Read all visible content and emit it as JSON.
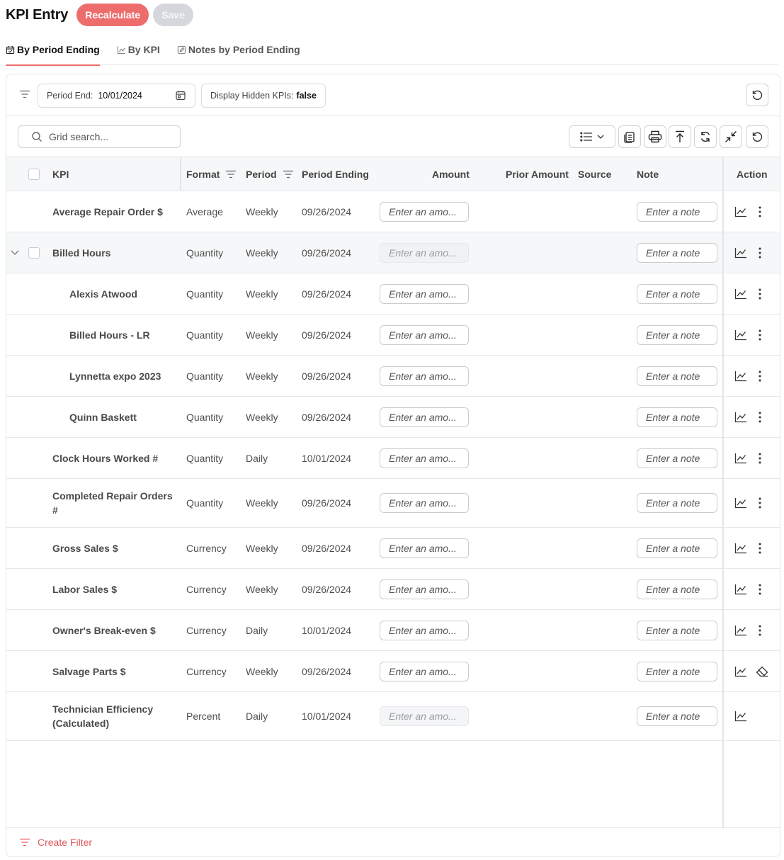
{
  "header": {
    "title": "KPI Entry",
    "recalculate_label": "Recalculate",
    "save_label": "Save"
  },
  "tabs": [
    {
      "label": "By Period Ending",
      "icon": "calendar-check-icon",
      "active": true
    },
    {
      "label": "By KPI",
      "icon": "chart-line-icon",
      "active": false
    },
    {
      "label": "Notes by Period Ending",
      "icon": "edit-note-icon",
      "active": false
    }
  ],
  "filters": {
    "period_end_label": "Period End:",
    "period_end_value": "10/01/2024",
    "hidden_label": "Display Hidden KPIs:",
    "hidden_value": "false"
  },
  "search": {
    "placeholder": "Grid search..."
  },
  "columns": {
    "kpi": "KPI",
    "format": "Format",
    "period": "Period",
    "period_ending": "Period Ending",
    "amount": "Amount",
    "prior_amount": "Prior Amount",
    "source": "Source",
    "note": "Note",
    "action": "Action"
  },
  "placeholders": {
    "amount": "Enter an amo...",
    "note": "Enter a note"
  },
  "rows": [
    {
      "kpi": "Average Repair Order $",
      "format": "Average",
      "period": "Weekly",
      "period_ending": "09/26/2024",
      "child": false,
      "amount_disabled": false,
      "menu": "more-vertical-icon"
    },
    {
      "kpi": "Billed Hours",
      "format": "Quantity",
      "period": "Weekly",
      "period_ending": "09/26/2024",
      "child": false,
      "group": true,
      "amount_disabled": true,
      "menu": "more-vertical-icon"
    },
    {
      "kpi": "Alexis Atwood",
      "format": "Quantity",
      "period": "Weekly",
      "period_ending": "09/26/2024",
      "child": true,
      "amount_disabled": false,
      "menu": "more-vertical-icon"
    },
    {
      "kpi": "Billed Hours - LR",
      "format": "Quantity",
      "period": "Weekly",
      "period_ending": "09/26/2024",
      "child": true,
      "amount_disabled": false,
      "menu": "more-vertical-icon"
    },
    {
      "kpi": "Lynnetta expo 2023",
      "format": "Quantity",
      "period": "Weekly",
      "period_ending": "09/26/2024",
      "child": true,
      "amount_disabled": false,
      "menu": "more-vertical-icon"
    },
    {
      "kpi": "Quinn Baskett",
      "format": "Quantity",
      "period": "Weekly",
      "period_ending": "09/26/2024",
      "child": true,
      "amount_disabled": false,
      "menu": "more-vertical-icon"
    },
    {
      "kpi": "Clock Hours Worked #",
      "format": "Quantity",
      "period": "Daily",
      "period_ending": "10/01/2024",
      "child": false,
      "amount_disabled": false,
      "menu": "more-vertical-icon"
    },
    {
      "kpi": "Completed Repair Orders #",
      "format": "Quantity",
      "period": "Weekly",
      "period_ending": "09/26/2024",
      "child": false,
      "amount_disabled": false,
      "menu": "more-vertical-icon"
    },
    {
      "kpi": "Gross Sales $",
      "format": "Currency",
      "period": "Weekly",
      "period_ending": "09/26/2024",
      "child": false,
      "amount_disabled": false,
      "menu": "more-vertical-icon"
    },
    {
      "kpi": "Labor Sales $",
      "format": "Currency",
      "period": "Weekly",
      "period_ending": "09/26/2024",
      "child": false,
      "amount_disabled": false,
      "menu": "more-vertical-icon"
    },
    {
      "kpi": "Owner's Break-even $",
      "format": "Currency",
      "period": "Daily",
      "period_ending": "10/01/2024",
      "child": false,
      "amount_disabled": false,
      "menu": "more-vertical-icon"
    },
    {
      "kpi": "Salvage Parts $",
      "format": "Currency",
      "period": "Weekly",
      "period_ending": "09/26/2024",
      "child": false,
      "amount_disabled": false,
      "menu": "eraser-icon"
    },
    {
      "kpi": "Technician Efficiency (Calculated)",
      "format": "Percent",
      "period": "Daily",
      "period_ending": "10/01/2024",
      "child": false,
      "amount_disabled": true,
      "menu": ""
    }
  ],
  "footer": {
    "create_filter_label": "Create Filter"
  },
  "colors": {
    "accent": "#ed6d6d",
    "accent_text": "#e0595a",
    "disabled": "#d5d7dc"
  }
}
